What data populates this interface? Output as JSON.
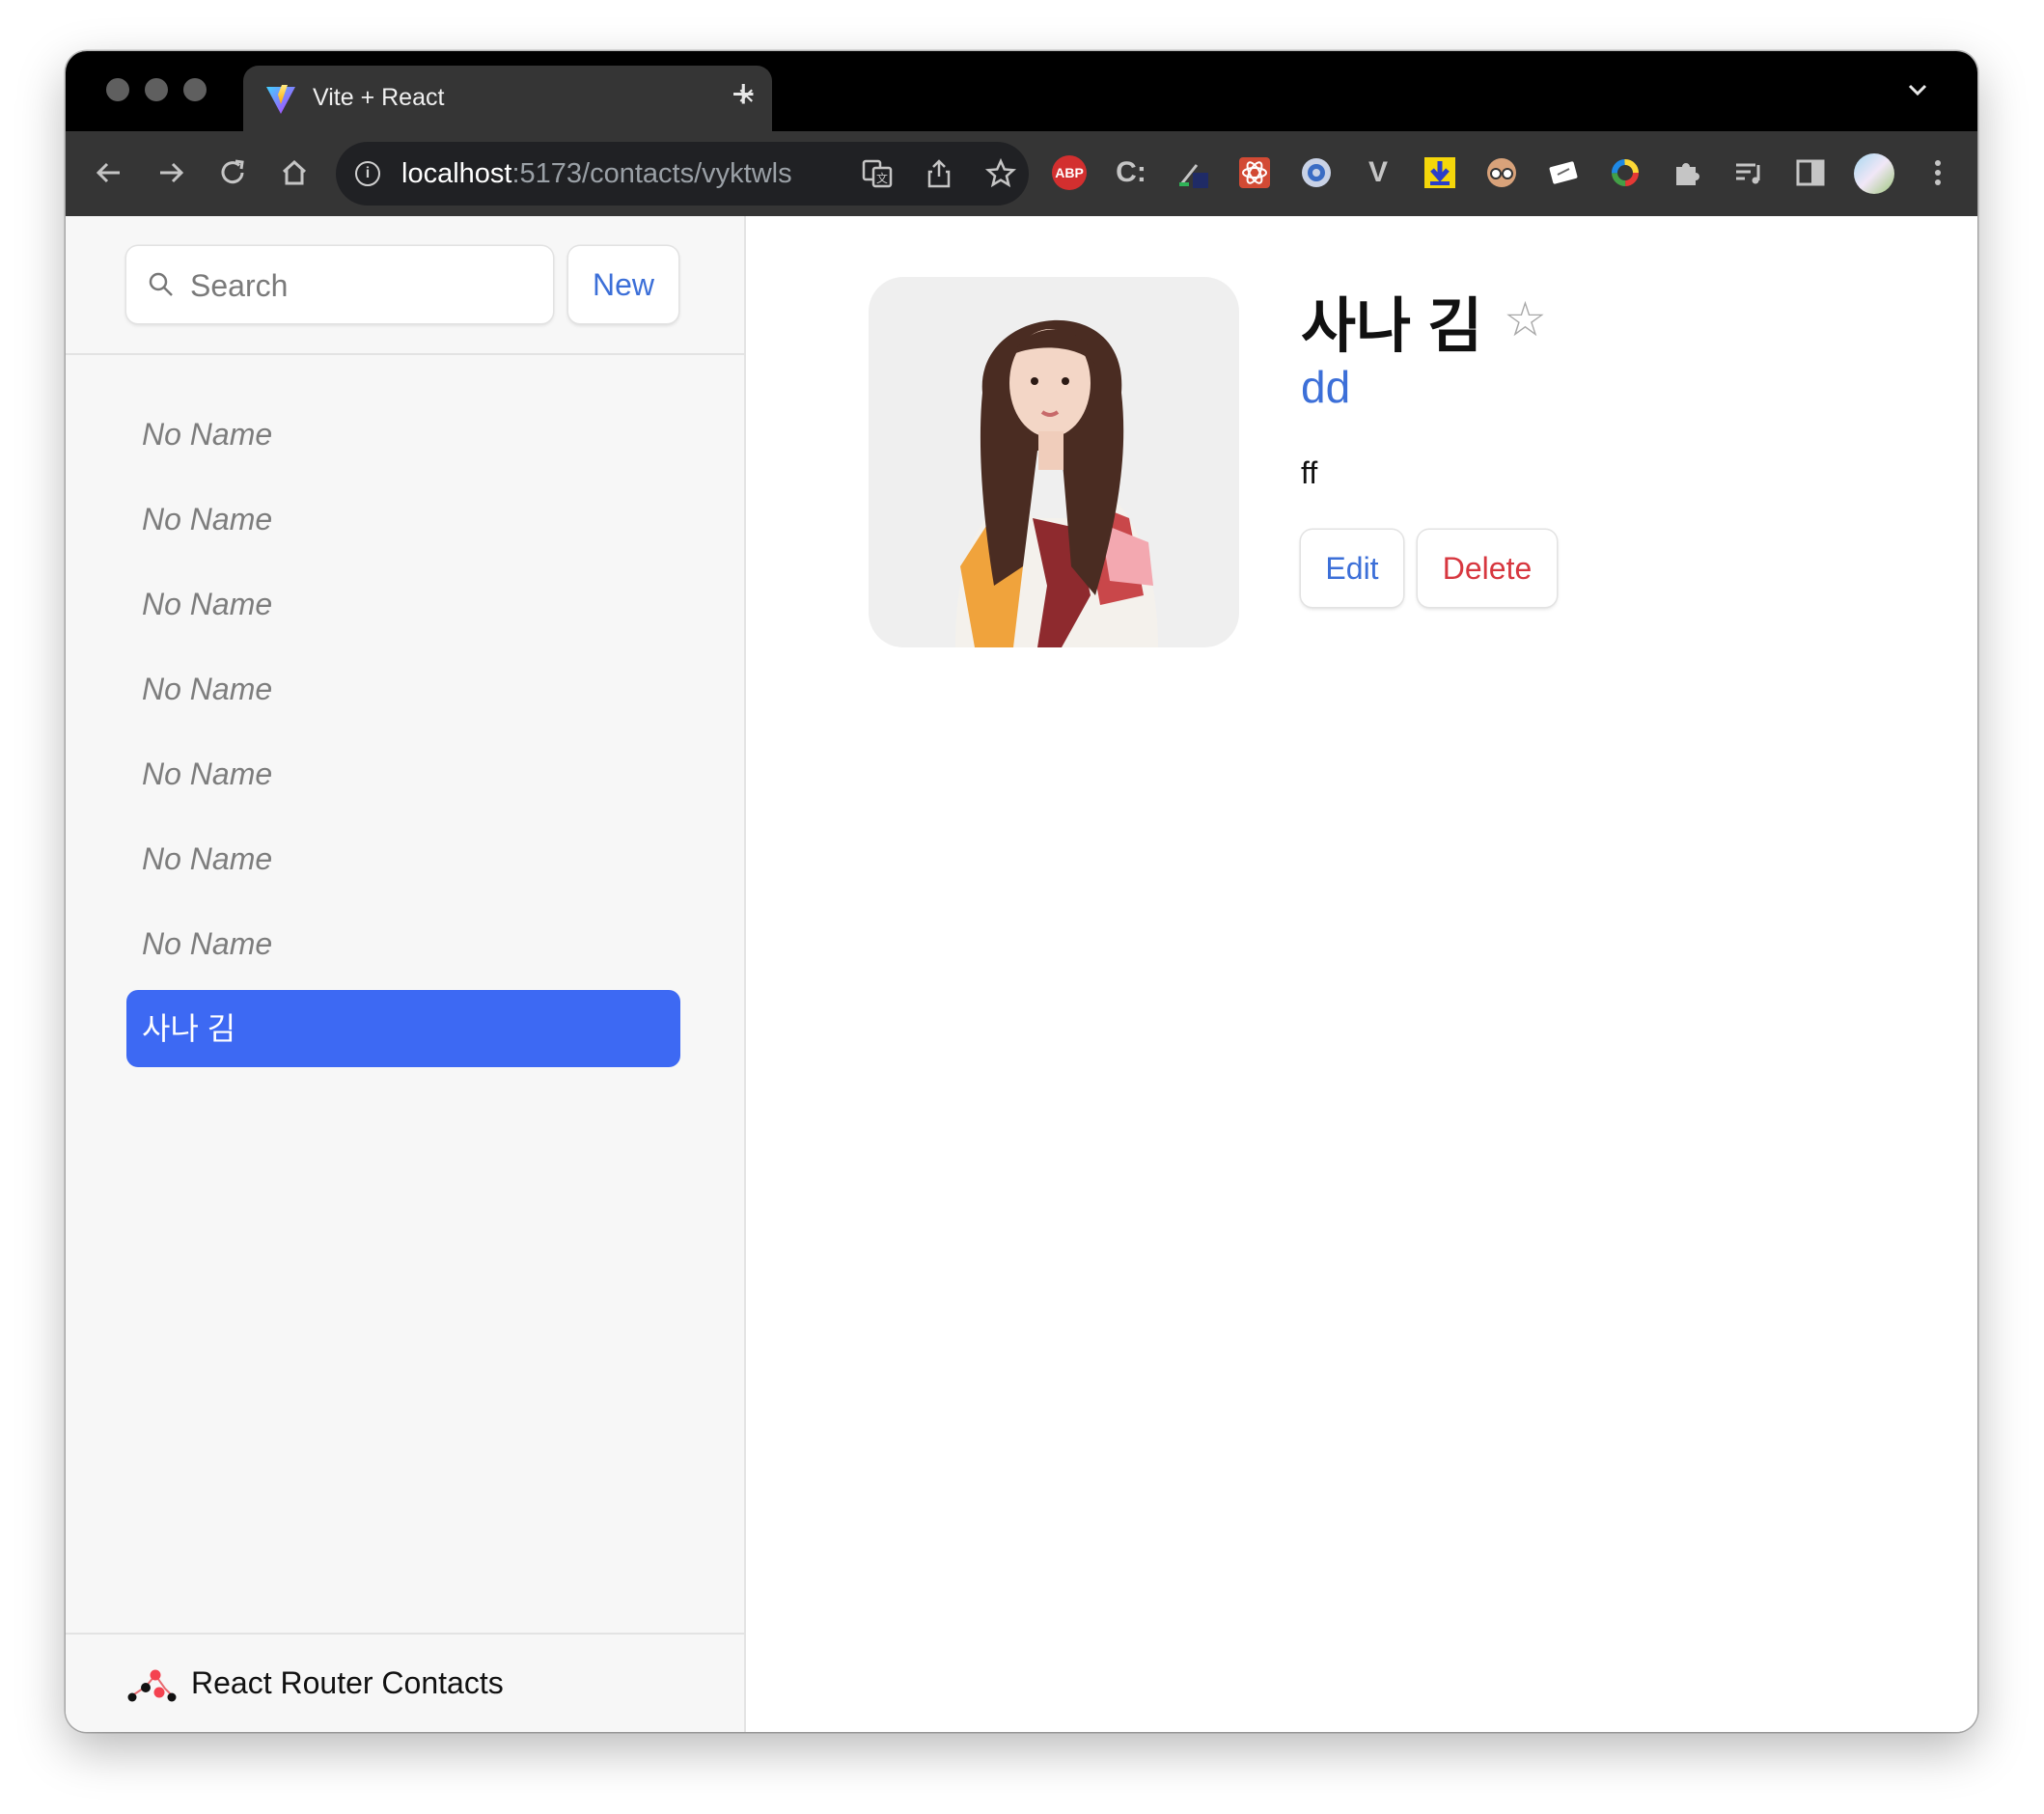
{
  "browser": {
    "tab_title": "Vite + React",
    "close_glyph": "×",
    "new_tab_glyph": "+",
    "url_host": "localhost",
    "url_path": ":5173/contacts/vyktwls",
    "extensions": [
      "ABP",
      "C:",
      "V"
    ]
  },
  "sidebar": {
    "search_placeholder": "Search",
    "new_button_label": "New",
    "contacts": [
      "No Name",
      "No Name",
      "No Name",
      "No Name",
      "No Name",
      "No Name",
      "No Name",
      "사나 김"
    ],
    "footer_title": "React Router Contacts"
  },
  "contact": {
    "name": "사나 김",
    "twitter": "dd",
    "notes": "ff",
    "edit_label": "Edit",
    "delete_label": "Delete",
    "favorite_glyph": "☆"
  },
  "colors": {
    "accent": "#3d69f3",
    "link": "#3c6fd8",
    "danger": "#d7373f"
  }
}
